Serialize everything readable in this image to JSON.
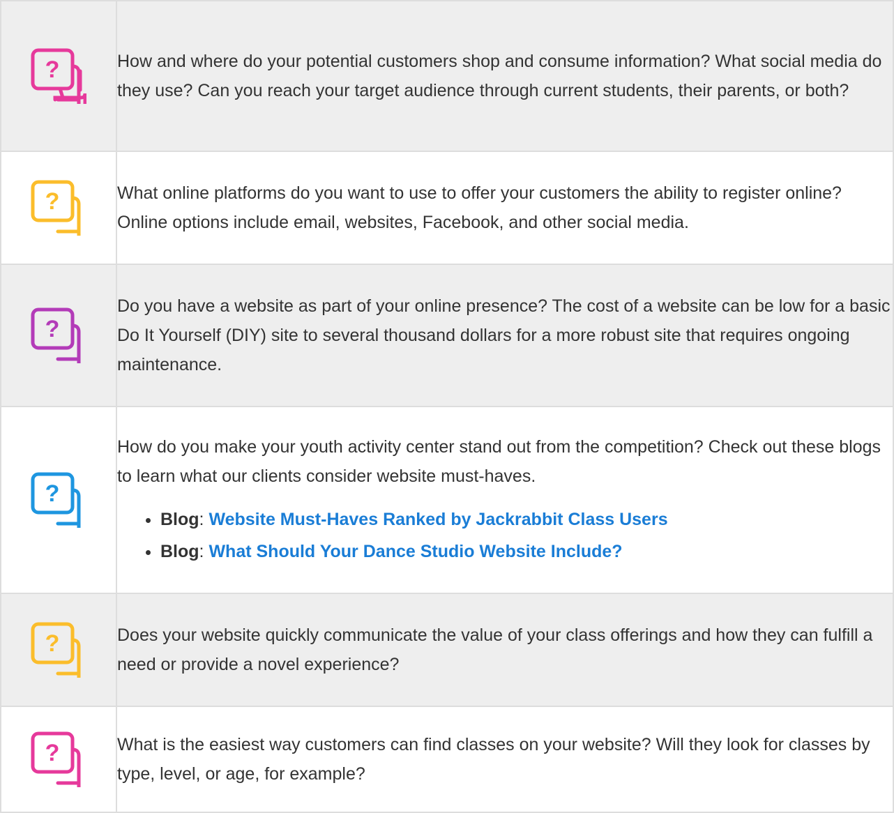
{
  "rows": [
    {
      "icon": "question-bubbles-icon",
      "icon_color": "#e6399b",
      "text": "How and where do your potential customers shop and consume information? What social media do they use? Can you reach your target audience through current students, their parents, or both?"
    },
    {
      "icon": "question-bubbles-icon",
      "icon_color": "#fbbd2b",
      "text": "What online platforms do you want to use to offer your customers the ability to register online? Online options include email, websites, Facebook, and other social media."
    },
    {
      "icon": "question-bubbles-icon",
      "icon_color": "#b33bb8",
      "text": "Do you have a website as part of your online presence? The cost of a website can be low for a basic Do It Yourself (DIY) site to several thousand dollars for a more robust site that requires ongoing maintenance."
    },
    {
      "icon": "question-bubbles-icon",
      "icon_color": "#1e96e0",
      "text": "How do you make your youth activity center stand out from the competition? Check out these blogs to learn what our clients consider website must-haves.",
      "links": [
        {
          "prefix": "Blog",
          "separator": ":",
          "label": "Website Must-Haves Ranked by Jackrabbit Class Users"
        },
        {
          "prefix": "Blog",
          "separator": ":",
          "label": "What Should Your Dance Studio Website Include?"
        }
      ]
    },
    {
      "icon": "question-bubbles-icon",
      "icon_color": "#fbbd2b",
      "text": "Does your website quickly communicate the value of your class offerings and how they can fulfill a need or provide a novel experience?"
    },
    {
      "icon": "question-bubbles-icon",
      "icon_color": "#e6399b",
      "text": "What is the easiest way customers can find classes on your website? Will they look for classes by type, level, or age, for example?"
    }
  ],
  "colors": {
    "shaded_row": "#eeeeee",
    "border": "#dddddd",
    "link": "#1a7dd6",
    "text": "#333333"
  }
}
